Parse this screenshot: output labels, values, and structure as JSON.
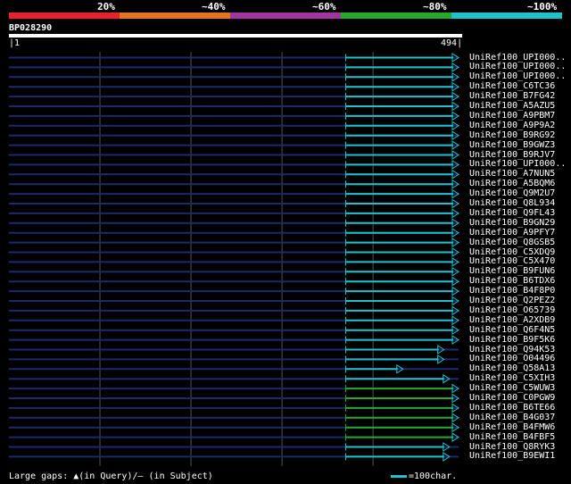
{
  "legend": [
    {
      "label": "20%",
      "color": "#e8212e"
    },
    {
      "label": "~40%",
      "color": "#e27420"
    },
    {
      "label": "~60%",
      "color": "#a0359e"
    },
    {
      "label": "~80%",
      "color": "#29a72a"
    },
    {
      "label": "~100%",
      "color": "#21c1c9"
    }
  ],
  "query": {
    "id": "BP028290",
    "start": "1",
    "end": "494"
  },
  "footer": {
    "gaps_text": "Large gaps: ▲(in Query)/― (in Subject)",
    "scale_text": "=100char."
  },
  "chart_data": {
    "type": "alignment",
    "query_length": 494,
    "hits": [
      {
        "name": "UniRef100_UPI000..",
        "start": 370,
        "end": 494,
        "identity": "~100%"
      },
      {
        "name": "UniRef100_UPI000..",
        "start": 370,
        "end": 494,
        "identity": "~100%"
      },
      {
        "name": "UniRef100_UPI000..",
        "start": 370,
        "end": 494,
        "identity": "~100%"
      },
      {
        "name": "UniRef100_C6TC36",
        "start": 370,
        "end": 494,
        "identity": "~100%"
      },
      {
        "name": "UniRef100_B7FG42",
        "start": 370,
        "end": 494,
        "identity": "~100%"
      },
      {
        "name": "UniRef100_A5AZU5",
        "start": 370,
        "end": 494,
        "identity": "~100%"
      },
      {
        "name": "UniRef100_A9PBM7",
        "start": 370,
        "end": 494,
        "identity": "~100%"
      },
      {
        "name": "UniRef100_A9P9A2",
        "start": 370,
        "end": 494,
        "identity": "~100%"
      },
      {
        "name": "UniRef100_B9RG92",
        "start": 370,
        "end": 494,
        "identity": "~100%"
      },
      {
        "name": "UniRef100_B9GWZ3",
        "start": 370,
        "end": 494,
        "identity": "~100%"
      },
      {
        "name": "UniRef100_B9RJV7",
        "start": 370,
        "end": 494,
        "identity": "~100%"
      },
      {
        "name": "UniRef100_UPI000..",
        "start": 370,
        "end": 494,
        "identity": "~100%"
      },
      {
        "name": "UniRef100_A7NUN5",
        "start": 370,
        "end": 494,
        "identity": "~100%"
      },
      {
        "name": "UniRef100_A5BQM6",
        "start": 370,
        "end": 494,
        "identity": "~100%"
      },
      {
        "name": "UniRef100_Q9M2U7",
        "start": 370,
        "end": 494,
        "identity": "~100%"
      },
      {
        "name": "UniRef100_Q8L934",
        "start": 370,
        "end": 494,
        "identity": "~100%"
      },
      {
        "name": "UniRef100_Q9FL43",
        "start": 370,
        "end": 494,
        "identity": "~100%"
      },
      {
        "name": "UniRef100_B9GN29",
        "start": 370,
        "end": 494,
        "identity": "~100%"
      },
      {
        "name": "UniRef100_A9PFY7",
        "start": 370,
        "end": 494,
        "identity": "~100%"
      },
      {
        "name": "UniRef100_Q8GSB5",
        "start": 370,
        "end": 494,
        "identity": "~100%"
      },
      {
        "name": "UniRef100_C5XDQ9",
        "start": 370,
        "end": 494,
        "identity": "~100%"
      },
      {
        "name": "UniRef100_C5X470",
        "start": 370,
        "end": 494,
        "identity": "~100%"
      },
      {
        "name": "UniRef100_B9FUN6",
        "start": 370,
        "end": 494,
        "identity": "~100%"
      },
      {
        "name": "UniRef100_B6TDX6",
        "start": 370,
        "end": 494,
        "identity": "~100%"
      },
      {
        "name": "UniRef100_B4F8P0",
        "start": 370,
        "end": 494,
        "identity": "~100%"
      },
      {
        "name": "UniRef100_Q2PEZ2",
        "start": 370,
        "end": 494,
        "identity": "~100%"
      },
      {
        "name": "UniRef100_O65739",
        "start": 370,
        "end": 494,
        "identity": "~100%"
      },
      {
        "name": "UniRef100_A2XDB9",
        "start": 370,
        "end": 494,
        "identity": "~100%"
      },
      {
        "name": "UniRef100_Q6F4N5",
        "start": 370,
        "end": 494,
        "identity": "~100%"
      },
      {
        "name": "UniRef100_B9F5K6",
        "start": 370,
        "end": 494,
        "identity": "~100%"
      },
      {
        "name": "UniRef100_Q94K53",
        "start": 370,
        "end": 478,
        "identity": "~100%"
      },
      {
        "name": "UniRef100_O04496",
        "start": 370,
        "end": 478,
        "identity": "~100%"
      },
      {
        "name": "UniRef100_Q58A13",
        "start": 370,
        "end": 433,
        "identity": "~100%"
      },
      {
        "name": "UniRef100_C5XIH3",
        "start": 370,
        "end": 484,
        "identity": "~100%"
      },
      {
        "name": "UniRef100_C5WUW3",
        "start": 370,
        "end": 494,
        "identity": "~80%"
      },
      {
        "name": "UniRef100_C0PGW9",
        "start": 370,
        "end": 494,
        "identity": "~80%"
      },
      {
        "name": "UniRef100_B6TE66",
        "start": 370,
        "end": 494,
        "identity": "~80%"
      },
      {
        "name": "UniRef100_B4G037",
        "start": 370,
        "end": 494,
        "identity": "~80%"
      },
      {
        "name": "UniRef100_B4FMW6",
        "start": 370,
        "end": 494,
        "identity": "~80%"
      },
      {
        "name": "UniRef100_B4FBF5",
        "start": 370,
        "end": 494,
        "identity": "~80%"
      },
      {
        "name": "UniRef100_Q8RYK3",
        "start": 370,
        "end": 484,
        "identity": "~100%"
      },
      {
        "name": "UniRef100_B9EWI1",
        "start": 370,
        "end": 484,
        "identity": "~100%"
      }
    ]
  }
}
